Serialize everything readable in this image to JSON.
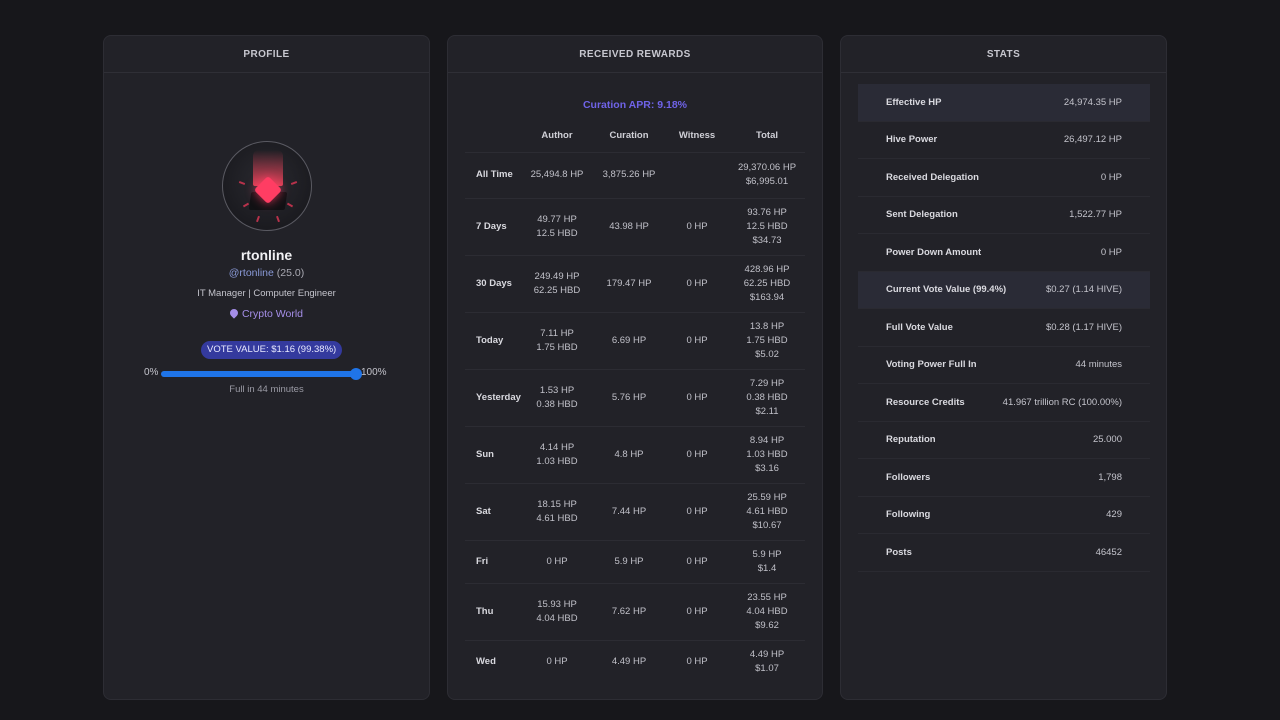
{
  "profile": {
    "title": "PROFILE",
    "username": "rtonline",
    "handle": "@rtonline",
    "reputation": "(25.0)",
    "bio": "IT Manager | Computer Engineer",
    "location": "Crypto World",
    "vote_badge": "VOTE VALUE: $1.16 (99.38%)",
    "slider_min": "0%",
    "slider_max": "100%",
    "voting_power_fraction": 0.9938,
    "full_in": "Full in 44 minutes"
  },
  "rewards": {
    "title": "RECEIVED REWARDS",
    "apr": "Curation APR: 9.18%",
    "columns": [
      "",
      "Author",
      "Curation",
      "Witness",
      "Total"
    ],
    "rows": [
      {
        "label": "All Time",
        "author": [
          "25,494.8 HP"
        ],
        "curation": [
          "3,875.26 HP"
        ],
        "witness": [],
        "total": [
          "29,370.06 HP",
          "$6,995.01"
        ]
      },
      {
        "label": "7 Days",
        "author": [
          "49.77 HP",
          "12.5 HBD"
        ],
        "curation": [
          "43.98 HP"
        ],
        "witness": [
          "0 HP"
        ],
        "total": [
          "93.76 HP",
          "12.5 HBD",
          "$34.73"
        ]
      },
      {
        "label": "30 Days",
        "author": [
          "249.49 HP",
          "62.25 HBD"
        ],
        "curation": [
          "179.47 HP"
        ],
        "witness": [
          "0 HP"
        ],
        "total": [
          "428.96 HP",
          "62.25 HBD",
          "$163.94"
        ]
      },
      {
        "label": "Today",
        "author": [
          "7.11 HP",
          "1.75 HBD"
        ],
        "curation": [
          "6.69 HP"
        ],
        "witness": [
          "0 HP"
        ],
        "total": [
          "13.8 HP",
          "1.75 HBD",
          "$5.02"
        ]
      },
      {
        "label": "Yesterday",
        "author": [
          "1.53 HP",
          "0.38 HBD"
        ],
        "curation": [
          "5.76 HP"
        ],
        "witness": [
          "0 HP"
        ],
        "total": [
          "7.29 HP",
          "0.38 HBD",
          "$2.11"
        ]
      },
      {
        "label": "Sun",
        "author": [
          "4.14 HP",
          "1.03 HBD"
        ],
        "curation": [
          "4.8 HP"
        ],
        "witness": [
          "0 HP"
        ],
        "total": [
          "8.94 HP",
          "1.03 HBD",
          "$3.16"
        ]
      },
      {
        "label": "Sat",
        "author": [
          "18.15 HP",
          "4.61 HBD"
        ],
        "curation": [
          "7.44 HP"
        ],
        "witness": [
          "0 HP"
        ],
        "total": [
          "25.59 HP",
          "4.61 HBD",
          "$10.67"
        ]
      },
      {
        "label": "Fri",
        "author": [
          "0 HP"
        ],
        "curation": [
          "5.9 HP"
        ],
        "witness": [
          "0 HP"
        ],
        "total": [
          "5.9 HP",
          "$1.4"
        ]
      },
      {
        "label": "Thu",
        "author": [
          "15.93 HP",
          "4.04 HBD"
        ],
        "curation": [
          "7.62 HP"
        ],
        "witness": [
          "0 HP"
        ],
        "total": [
          "23.55 HP",
          "4.04 HBD",
          "$9.62"
        ]
      },
      {
        "label": "Wed",
        "author": [
          "0 HP"
        ],
        "curation": [
          "4.49 HP"
        ],
        "witness": [
          "0 HP"
        ],
        "total": [
          "4.49 HP",
          "$1.07"
        ]
      }
    ]
  },
  "stats": {
    "title": "STATS",
    "rows": [
      {
        "label": "Effective HP",
        "value": "24,974.35 HP",
        "highlight": true
      },
      {
        "label": "Hive Power",
        "value": "26,497.12 HP",
        "highlight": false
      },
      {
        "label": "Received Delegation",
        "value": "0 HP",
        "highlight": false
      },
      {
        "label": "Sent Delegation",
        "value": "1,522.77 HP",
        "highlight": false
      },
      {
        "label": "Power Down Amount",
        "value": "0 HP",
        "highlight": false
      },
      {
        "label": "Current Vote Value (99.4%)",
        "value": "$0.27 (1.14 HIVE)",
        "highlight": true
      },
      {
        "label": "Full Vote Value",
        "value": "$0.28 (1.17 HIVE)",
        "highlight": false
      },
      {
        "label": "Voting Power Full In",
        "value": "44 minutes",
        "highlight": false
      },
      {
        "label": "Resource Credits",
        "value": "41.967 trillion RC (100.00%)",
        "highlight": false
      },
      {
        "label": "Reputation",
        "value": "25.000",
        "highlight": false
      },
      {
        "label": "Followers",
        "value": "1,798",
        "highlight": false
      },
      {
        "label": "Following",
        "value": "429",
        "highlight": false
      },
      {
        "label": "Posts",
        "value": "46452",
        "highlight": false
      }
    ]
  },
  "colors": {
    "background": "#17171b",
    "panel": "#222228",
    "accent_blue": "#1f74e8",
    "apr_purple": "#6f63e8",
    "badge": "#343a9e"
  }
}
